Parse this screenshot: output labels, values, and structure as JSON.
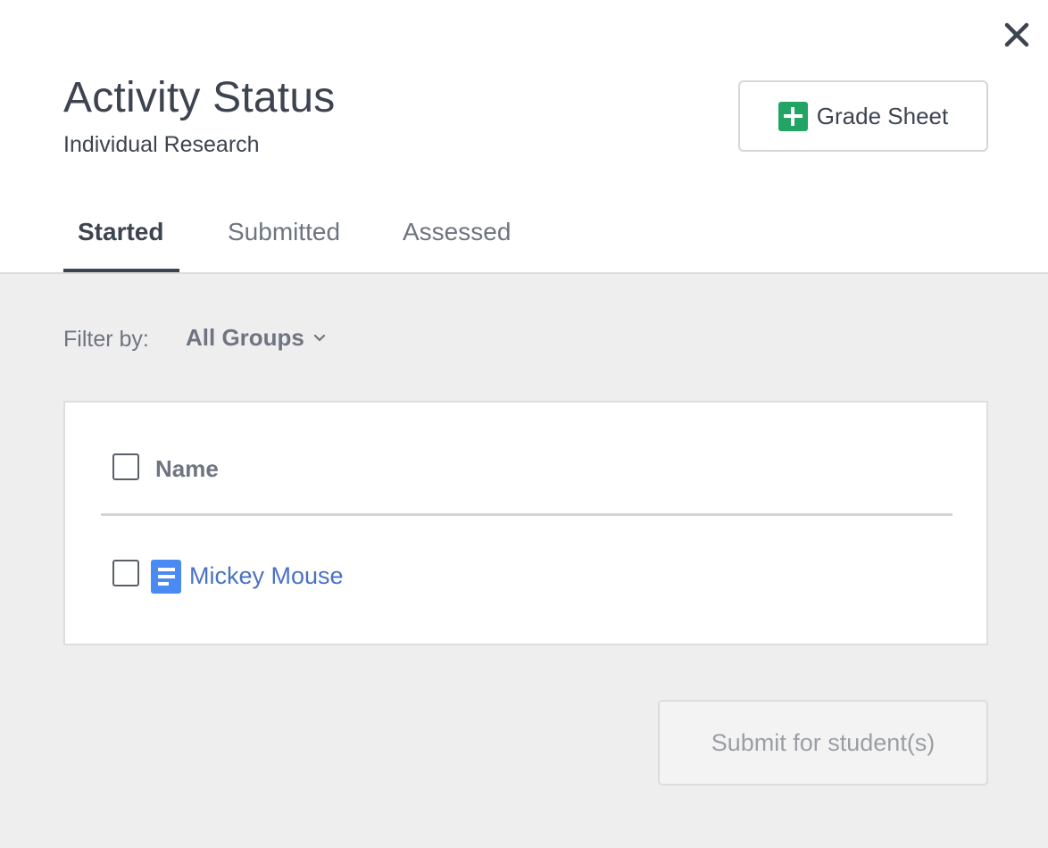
{
  "header": {
    "title": "Activity Status",
    "subtitle": "Individual Research",
    "grade_sheet_label": "Grade Sheet"
  },
  "tabs": [
    {
      "label": "Started",
      "active": true
    },
    {
      "label": "Submitted",
      "active": false
    },
    {
      "label": "Assessed",
      "active": false
    }
  ],
  "filter": {
    "label": "Filter by:",
    "selected": "All Groups"
  },
  "table": {
    "column_header": "Name",
    "rows": [
      {
        "name": "Mickey Mouse",
        "icon": "document-icon",
        "checked": false
      }
    ]
  },
  "submit_label": "Submit for student(s)",
  "colors": {
    "accent_text": "#3d4450",
    "link": "#4a72c4",
    "grade_sheet_green": "#21a464",
    "doc_blue": "#4a8af4",
    "content_bg": "#eeeeee"
  }
}
